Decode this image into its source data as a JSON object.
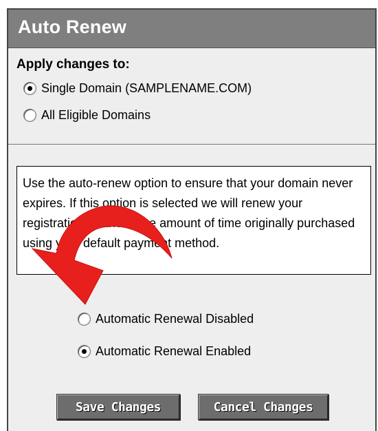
{
  "header": {
    "title": "Auto Renew"
  },
  "apply": {
    "heading": "Apply changes to:",
    "options": [
      {
        "label": "Single Domain (SAMPLENAME.COM)",
        "checked": true
      },
      {
        "label": "All Eligible Domains",
        "checked": false
      }
    ]
  },
  "info": {
    "text": "Use the auto-renew option to ensure that your domain never expires. If this option is selected we will renew your registration for the same amount of time originally purchased using your default payment method."
  },
  "renewal": {
    "options": [
      {
        "label": "Automatic Renewal Disabled",
        "checked": false
      },
      {
        "label": "Automatic Renewal Enabled",
        "checked": true
      }
    ]
  },
  "buttons": {
    "save_label": "Save Changes",
    "cancel_label": "Cancel Changes"
  },
  "colors": {
    "header_bg": "#7f7f7f",
    "panel_bg": "#eeeeee",
    "button_bg": "#6d6d6d",
    "annotation_arrow": "#e8201d"
  },
  "icons": [
    "red-curved-arrow-icon"
  ]
}
